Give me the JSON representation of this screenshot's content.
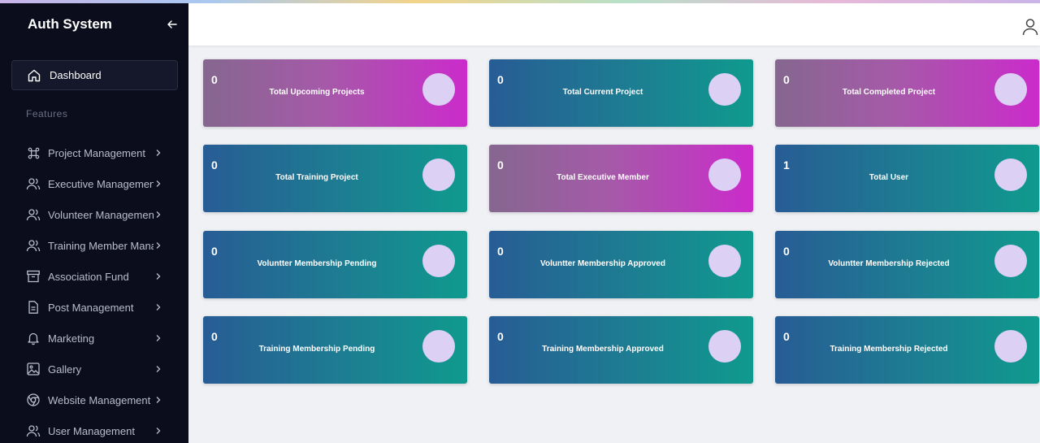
{
  "sidebar": {
    "brand": "Auth System",
    "dashboard_label": "Dashboard",
    "section_label": "Features",
    "items": [
      {
        "label": "Project Management",
        "icon": "command-icon"
      },
      {
        "label": "Executive Managemen",
        "icon": "users-icon"
      },
      {
        "label": "Volunteer Managemen",
        "icon": "users-icon"
      },
      {
        "label": "Training Member Mana",
        "icon": "users-icon"
      },
      {
        "label": "Association Fund",
        "icon": "archive-icon"
      },
      {
        "label": "Post Management",
        "icon": "document-icon"
      },
      {
        "label": "Marketing",
        "icon": "bell-icon"
      },
      {
        "label": "Gallery",
        "icon": "image-icon"
      },
      {
        "label": "Website Management",
        "icon": "chrome-icon"
      },
      {
        "label": "User Management",
        "icon": "users-icon"
      }
    ]
  },
  "cards": [
    {
      "value": "0",
      "title": "Total Upcoming Projects"
    },
    {
      "value": "0",
      "title": "Total Current Project"
    },
    {
      "value": "0",
      "title": "Total Completed Project"
    },
    {
      "value": "0",
      "title": "Total Training Project"
    },
    {
      "value": "0",
      "title": "Total Executive Member"
    },
    {
      "value": "1",
      "title": "Total User"
    },
    {
      "value": "0",
      "title": "Voluntter Membership Pending"
    },
    {
      "value": "0",
      "title": "Voluntter Membership Approved"
    },
    {
      "value": "0",
      "title": "Voluntter Membership Rejected"
    },
    {
      "value": "0",
      "title": "Training Membership Pending"
    },
    {
      "value": "0",
      "title": "Training Membership Approved"
    },
    {
      "value": "0",
      "title": "Training Membership Rejected"
    }
  ],
  "colors": {
    "sidebar_bg": "#0b0d1c",
    "card_pink_end": "#cb2bcb",
    "card_teal_end": "#0f9a8e",
    "circle": "#dcd0f5"
  }
}
